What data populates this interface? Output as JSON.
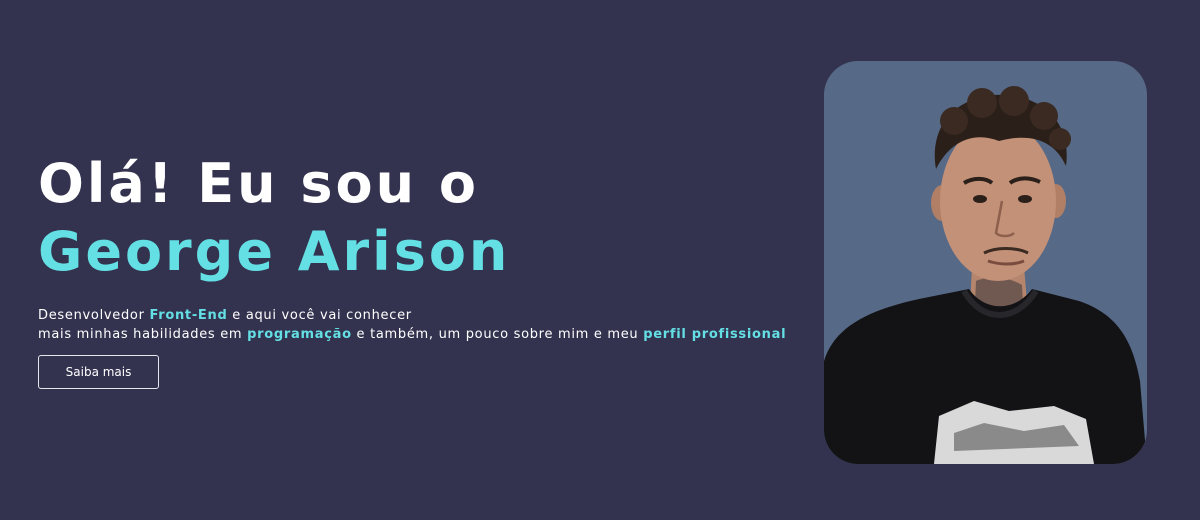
{
  "hero": {
    "headline_line1": "Olá! Eu sou o",
    "headline_name": "George Arison",
    "description": {
      "line1_before": "Desenvolvedor ",
      "line1_highlight": "Front-End",
      "line1_after": " e aqui você vai conhecer",
      "line2_before": "mais minhas habilidades em ",
      "line2_highlight1": "programação",
      "line2_middle": " e também, um pouco sobre mim e meu ",
      "line2_highlight2": "perfil profissional"
    },
    "cta_label": "Saiba mais"
  },
  "profile_photo": {
    "description": "portrait-photo"
  },
  "colors": {
    "background": "#333350",
    "accent": "#64dfe4",
    "text": "#ffffff",
    "photo_background": "#566986"
  }
}
